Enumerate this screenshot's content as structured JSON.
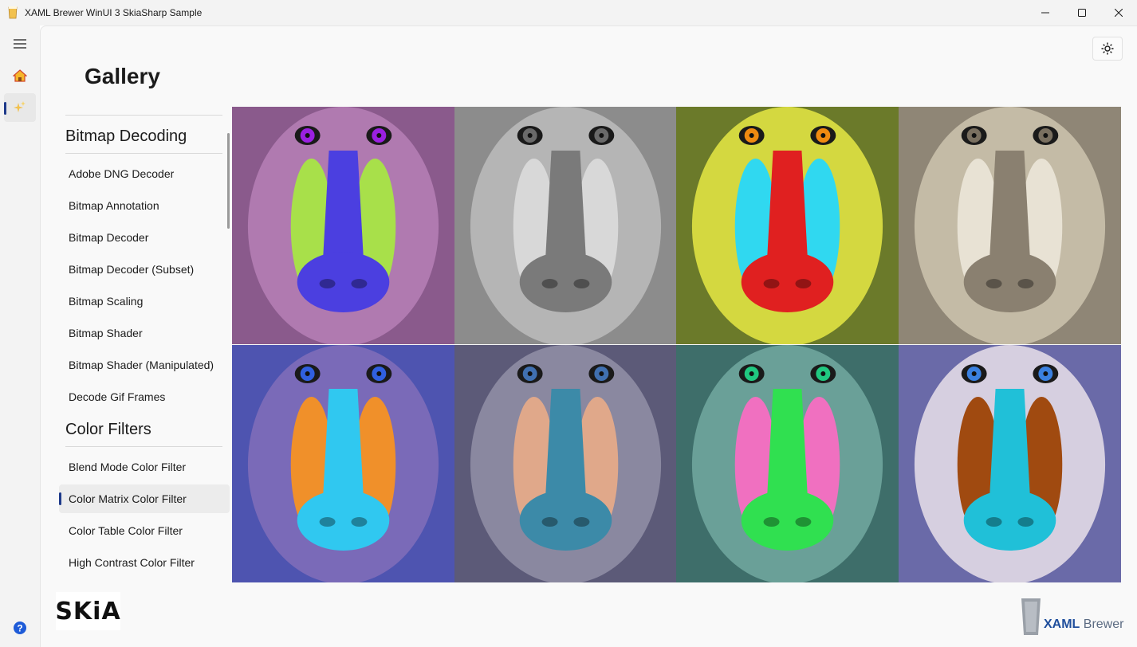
{
  "window": {
    "title": "XAML Brewer WinUI 3 SkiaSharp Sample",
    "controls": [
      "minimize-icon",
      "maximize-icon",
      "close-icon"
    ]
  },
  "rail": {
    "items": [
      {
        "icon": "hamburger-icon"
      },
      {
        "icon": "home-icon"
      },
      {
        "icon": "sparkle-icon",
        "selected": true
      }
    ],
    "footer_icon": "help-icon"
  },
  "page": {
    "title": "Gallery",
    "theme_toggle_icon": "sun-icon"
  },
  "list": {
    "groups": [
      {
        "header": "Bitmap Decoding",
        "items": [
          "Adobe DNG Decoder",
          "Bitmap Annotation",
          "Bitmap Decoder",
          "Bitmap Decoder (Subset)",
          "Bitmap Scaling",
          "Bitmap Shader",
          "Bitmap Shader (Manipulated)",
          "Decode Gif Frames"
        ]
      },
      {
        "header": "Color Filters",
        "items": [
          "Blend Mode Color Filter",
          "Color Matrix Color Filter",
          "Color Table Color Filter",
          "High Contrast Color Filter"
        ],
        "selected": "Color Matrix Color Filter"
      }
    ]
  },
  "gallery": {
    "subject": "mandrill",
    "tiles": [
      {
        "bg": "#8a5a8c",
        "fur": "#b07ab0",
        "nose": "#4b3fe0",
        "cheek": "#a8e04a",
        "eye": "#9a20e0"
      },
      {
        "bg": "#8c8c8c",
        "fur": "#b5b5b5",
        "nose": "#7a7a7a",
        "cheek": "#d8d8d8",
        "eye": "#6a6a6a"
      },
      {
        "bg": "#6b7a2a",
        "fur": "#d4d840",
        "nose": "#e02020",
        "cheek": "#30d8f0",
        "eye": "#f08a10"
      },
      {
        "bg": "#8f8676",
        "fur": "#c4bba6",
        "nose": "#8a8070",
        "cheek": "#e8e2d4",
        "eye": "#7a7060"
      },
      {
        "bg": "#4e54b0",
        "fur": "#7a6ab8",
        "nose": "#30c8f0",
        "cheek": "#f0902a",
        "eye": "#3060e0"
      },
      {
        "bg": "#5c5a78",
        "fur": "#8a88a0",
        "nose": "#3c8aa8",
        "cheek": "#e0a88a",
        "eye": "#4070b0"
      },
      {
        "bg": "#3e6e6a",
        "fur": "#6aa098",
        "nose": "#30e050",
        "cheek": "#f070c0",
        "eye": "#20c880"
      },
      {
        "bg": "#6a6aa8",
        "fur": "#d6cfe0",
        "nose": "#20c0d8",
        "cheek": "#a04a10",
        "eye": "#3a80e0"
      }
    ]
  },
  "footer": {
    "skia_logo": "SKiA",
    "brand_bold": "XAML",
    "brand_light": " Brewer"
  }
}
